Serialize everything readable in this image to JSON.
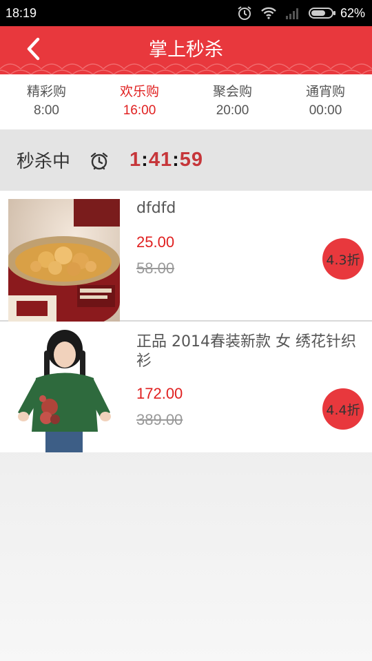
{
  "status_bar": {
    "time": "18:19",
    "battery": "62%",
    "icons": [
      "alarm-icon",
      "wifi-icon",
      "signal-icon",
      "battery-icon"
    ]
  },
  "header": {
    "title": "掌上秒杀",
    "back_icon": "chevron-left-icon",
    "accent_color": "#e8383d"
  },
  "tabs": [
    {
      "name": "精彩购",
      "time": "8:00",
      "active": false
    },
    {
      "name": "欢乐购",
      "time": "16:00",
      "active": true
    },
    {
      "name": "聚会购",
      "time": "20:00",
      "active": false
    },
    {
      "name": "通宵购",
      "time": "00:00",
      "active": false
    }
  ],
  "countdown": {
    "label": "秒杀中",
    "icon": "alarm-clock-icon",
    "hours": "1",
    "minutes": "41",
    "seconds": "59",
    "separator": ":"
  },
  "items": [
    {
      "title": "dfdfd",
      "price": "25.00",
      "original_price": "58.00",
      "discount": "4.3折",
      "image": "canned-sea-urchin-image"
    },
    {
      "title": "正品 2014春装新款 女 绣花针织衫",
      "price": "172.00",
      "original_price": "389.00",
      "discount": "4.4折",
      "image": "green-knit-cardigan-image"
    }
  ]
}
